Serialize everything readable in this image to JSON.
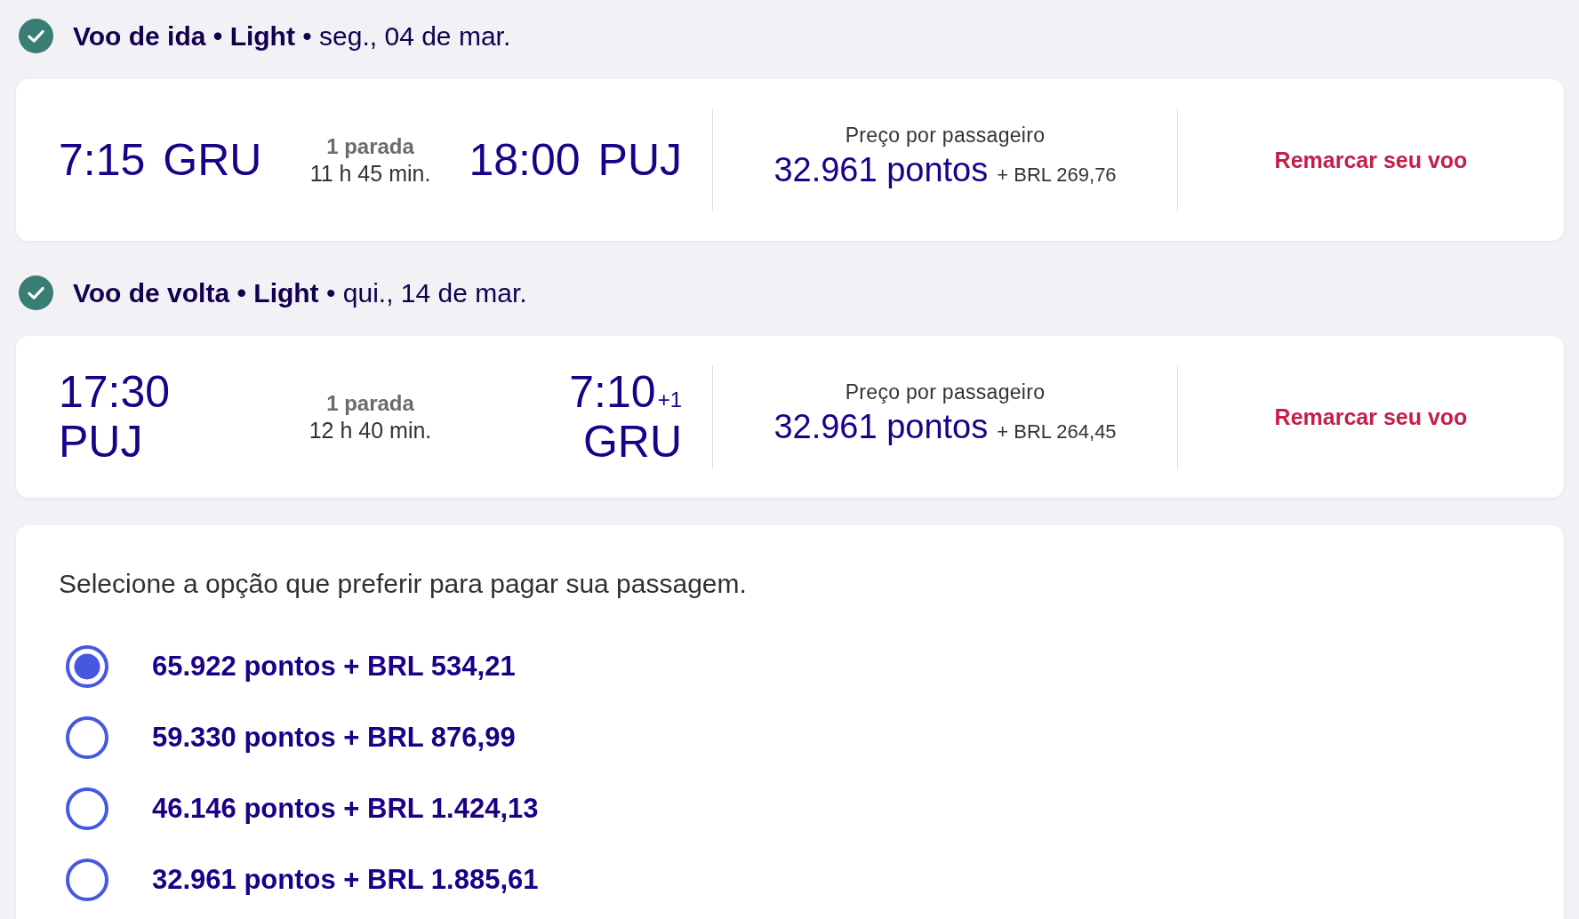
{
  "flights": [
    {
      "header": "**Voo de ida • Light** • seg., 04 de mar.",
      "kind": "inline",
      "departure": {
        "time": "7:15",
        "airport": "GRU"
      },
      "stops": "1 parada",
      "duration": "11 h 45 min.",
      "arrival": {
        "time": "18:00",
        "airport": "PUJ"
      },
      "price_label": "Preço por passageiro",
      "points": "32.961 pontos",
      "cash": "+ BRL 269,76",
      "action": "Remarcar seu voo"
    },
    {
      "header": "**Voo de volta • Light** • qui., 14 de mar.",
      "kind": "stacked",
      "departure": {
        "time": "17:30",
        "airport": "PUJ"
      },
      "stops": "1 parada",
      "duration": "12 h 40 min.",
      "arrival": {
        "time": "7:10",
        "day_offset": "+1",
        "airport": "GRU"
      },
      "price_label": "Preço por passageiro",
      "points": "32.961 pontos",
      "cash": "+ BRL 264,45",
      "action": "Remarcar seu voo"
    }
  ],
  "payment": {
    "instruction": "Selecione a opção que preferir para pagar sua passagem.",
    "options": [
      {
        "label": "65.922 pontos + BRL 534,21",
        "selected": true
      },
      {
        "label": "59.330 pontos + BRL 876,99",
        "selected": false
      },
      {
        "label": "46.146 pontos + BRL 1.424,13",
        "selected": false
      },
      {
        "label": "32.961 pontos + BRL 1.885,61",
        "selected": false
      }
    ]
  }
}
